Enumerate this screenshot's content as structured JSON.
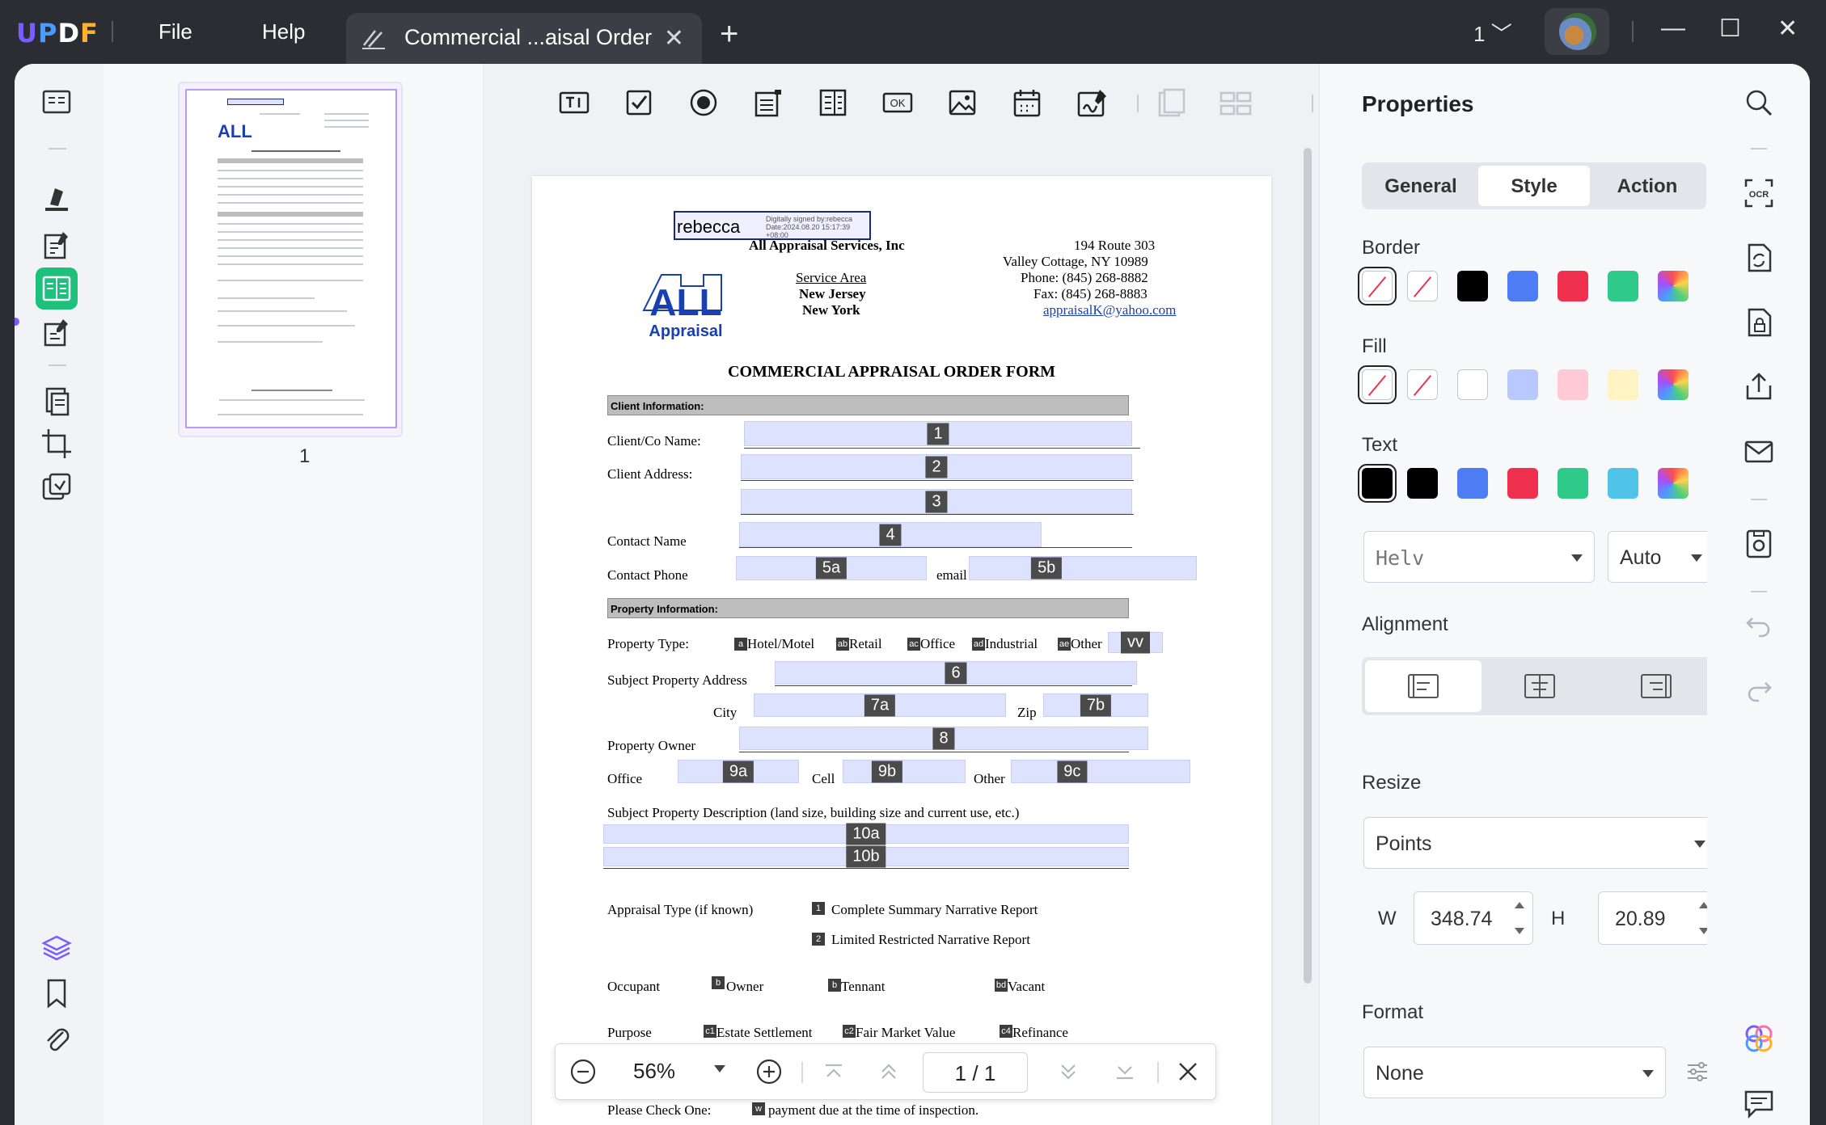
{
  "app": {
    "logo_text": "UPDF",
    "menus": [
      "File",
      "Help"
    ],
    "tab_title": "Commercial ...aisal Order",
    "page_selector": "1"
  },
  "thumbnail": {
    "page_label": "1"
  },
  "document": {
    "signature": {
      "name": "rebecca",
      "note": "Digitally signed by:rebecca Date:2024.08.20 15:17:39 +08:00"
    },
    "logo": {
      "main": "ALL",
      "sub": "Appraisal"
    },
    "company": "All Appraisal Services, Inc",
    "service_area": [
      "Service Area",
      "New Jersey",
      "New York"
    ],
    "address": [
      "194 Route 303",
      "Valley Cottage, NY 10989",
      "Phone:  (845) 268-8882",
      "Fax:  (845) 268-8883",
      "appraisalK@yahoo.com"
    ],
    "form_title": "COMMERCIAL APPRAISAL ORDER FORM",
    "sections": [
      "Client Information:",
      "Property Information:"
    ],
    "labels": {
      "client_name": "Client/Co Name:",
      "client_address": "Client Address:",
      "contact_name": "Contact Name",
      "contact_phone": "Contact Phone",
      "email": "email",
      "property_type": "Property Type:",
      "hotel": "Hotel/Motel",
      "retail": "Retail",
      "office": "Office",
      "industrial": "Industrial",
      "other": "Other",
      "subject_address": "Subject Property Address",
      "city": "City",
      "zip": "Zip",
      "owner": "Property Owner",
      "office_phone": "Office",
      "cell": "Cell",
      "other_phone": "Other",
      "description": "Subject Property Description (land size, building size and current use, etc.)",
      "appraisal_type": "Appraisal Type (if known)",
      "complete_summary": "Complete Summary Narrative Report",
      "limited_restricted": "Limited Restricted Narrative Report",
      "occupant": "Occupant",
      "occ_owner": "Owner",
      "occ_tennant": "Tennant",
      "occ_vacant": "Vacant",
      "purpose": "Purpose",
      "estate": "Estate Settlement",
      "fmv": "Fair Market Value",
      "refinance": "Refinance",
      "check_one": "Please Check One:",
      "payment": "payment due at the time of inspection."
    },
    "field_tags": {
      "f1": "1",
      "f2": "2",
      "f3": "3",
      "f4": "4",
      "f5a": "5a",
      "f5b": "5b",
      "vv": "vv",
      "f6": "6",
      "f7a": "7a",
      "f7b": "7b",
      "f8": "8",
      "f9a": "9a",
      "f9b": "9b",
      "f9c": "9c",
      "f10a": "10a",
      "f10b": "10b"
    },
    "checkbox_tags": {
      "hotel": "a",
      "retail": "ab",
      "office": "ac",
      "industrial": "ad",
      "other": "ae",
      "complete": "1",
      "limited": "2",
      "owner": "b",
      "tennant": "b",
      "vacant": "bd",
      "estate": "c1",
      "fmv": "c2",
      "refinance": "c4",
      "check_one": "w"
    }
  },
  "navbar": {
    "zoom": "56%",
    "page_current": "1",
    "page_sep": "/",
    "page_total": "1"
  },
  "properties": {
    "title": "Properties",
    "tabs": [
      "General",
      "Style",
      "Action"
    ],
    "active_tab": "Style",
    "border_label": "Border",
    "fill_label": "Fill",
    "text_label": "Text",
    "border_colors": [
      "none",
      "none",
      "#000000",
      "#4d7cf4",
      "#f0304f",
      "#2fc98a",
      "rainbow"
    ],
    "fill_colors": [
      "none",
      "none",
      "#ffffff",
      "#b9c8ff",
      "#ffc9d6",
      "#fff4c2",
      "rainbow"
    ],
    "text_colors": [
      "#000000",
      "#000000",
      "#4d7cf4",
      "#f0304f",
      "#2fc98a",
      "#4fc3e8",
      "rainbow"
    ],
    "font": "Helv",
    "font_size": "Auto",
    "alignment_label": "Alignment",
    "resize_label": "Resize",
    "resize_unit": "Points",
    "w_label": "W",
    "w_value": "348.74",
    "h_label": "H",
    "h_value": "20.89",
    "format_label": "Format",
    "format_value": "None"
  }
}
